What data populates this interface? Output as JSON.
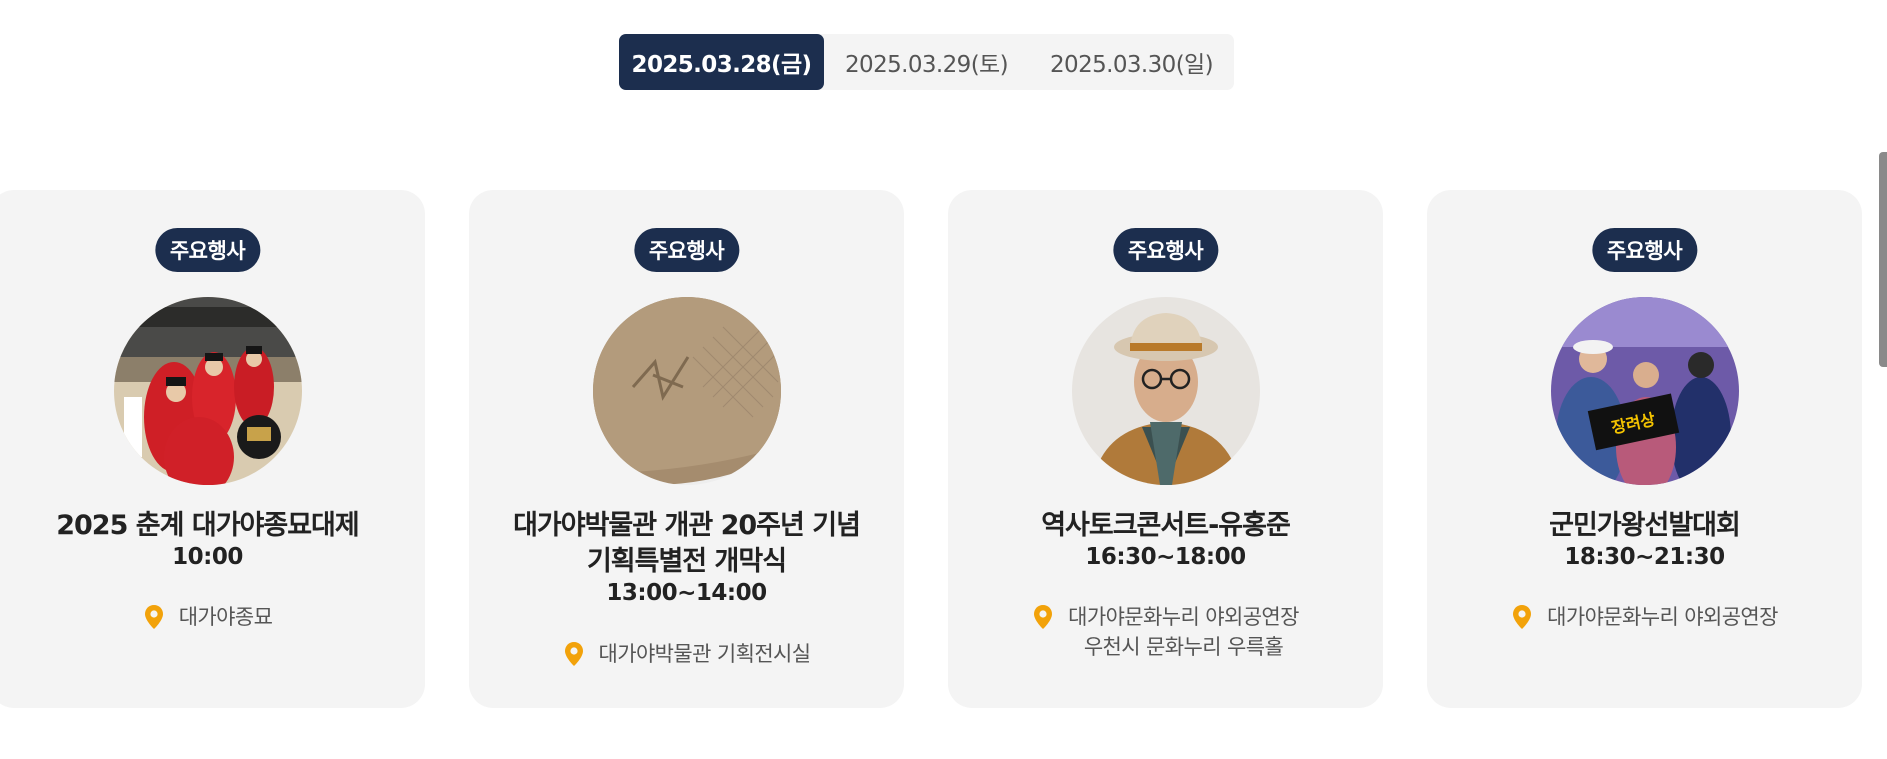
{
  "date_tabs": [
    {
      "label": "2025.03.28(금)",
      "active": true
    },
    {
      "label": "2025.03.29(토)",
      "active": false
    },
    {
      "label": "2025.03.30(일)",
      "active": false
    }
  ],
  "cards": [
    {
      "badge": "주요행사",
      "title_lines": [
        "2025 춘계 대가야종묘대제"
      ],
      "time": "10:00",
      "location_lines": [
        "대가야종묘"
      ],
      "image_icon": "ritual-procession-photo"
    },
    {
      "badge": "주요행사",
      "title_lines": [
        "대가야박물관 개관 20주년 기념",
        "기획특별전 개막식"
      ],
      "time": "13:00~14:00",
      "location_lines": [
        "대가야박물관 기획전시실"
      ],
      "image_icon": "pottery-shard-photo"
    },
    {
      "badge": "주요행사",
      "title_lines": [
        "역사토크콘서트-유홍준"
      ],
      "time": "16:30~18:00",
      "location_lines": [
        "대가야문화누리 야외공연장",
        "우천시 문화누리 우륵홀"
      ],
      "image_icon": "speaker-portrait-photo"
    },
    {
      "badge": "주요행사",
      "title_lines": [
        "군민가왕선발대회"
      ],
      "time": "18:30~21:30",
      "location_lines": [
        "대가야문화누리 야외공연장"
      ],
      "image_icon": "award-ceremony-photo"
    }
  ],
  "award_sign": "장려상",
  "colors": {
    "navy": "#1c2e4e",
    "card_bg": "#f4f4f4",
    "pin": "#f2a20a"
  }
}
